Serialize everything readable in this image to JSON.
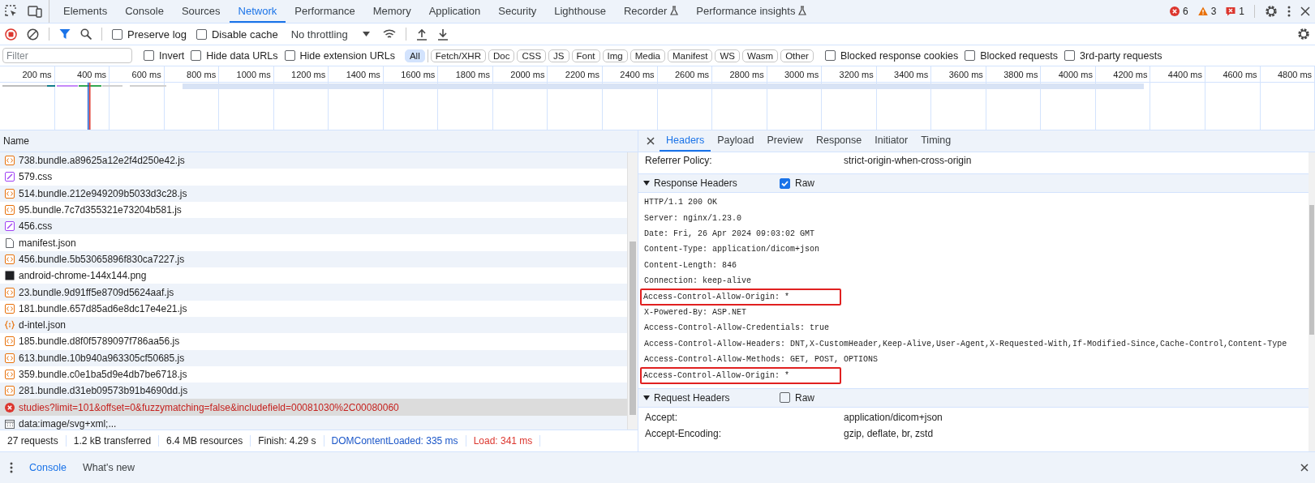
{
  "main_tabs": [
    {
      "label": "Elements",
      "kind": "plain",
      "selected": false
    },
    {
      "label": "Console",
      "kind": "plain",
      "selected": false
    },
    {
      "label": "Sources",
      "kind": "plain",
      "selected": false
    },
    {
      "label": "Network",
      "kind": "plain",
      "selected": true
    },
    {
      "label": "Performance",
      "kind": "plain",
      "selected": false
    },
    {
      "label": "Memory",
      "kind": "plain",
      "selected": false
    },
    {
      "label": "Application",
      "kind": "plain",
      "selected": false
    },
    {
      "label": "Security",
      "kind": "plain",
      "selected": false
    },
    {
      "label": "Lighthouse",
      "kind": "plain",
      "selected": false
    },
    {
      "label": "Recorder",
      "kind": "experimental",
      "selected": false
    },
    {
      "label": "Performance insights",
      "kind": "experimental",
      "selected": false
    }
  ],
  "issue_counts": [
    {
      "kind": "error",
      "count": "6"
    },
    {
      "kind": "warning",
      "count": "3"
    },
    {
      "kind": "issue",
      "count": "1"
    }
  ],
  "toolbar": {
    "recording": true,
    "options": [
      {
        "label": "Preserve log",
        "checked": false
      },
      {
        "label": "Disable cache",
        "checked": false
      }
    ],
    "throttling": "No throttling"
  },
  "filter": {
    "placeholder": "Filter",
    "options": [
      {
        "label": "Invert",
        "checked": false
      },
      {
        "label": "Hide data URLs",
        "checked": false
      },
      {
        "label": "Hide extension URLs",
        "checked": false
      }
    ],
    "types": [
      {
        "label": "All",
        "selected": true
      },
      {
        "label": "Fetch/XHR",
        "selected": false
      },
      {
        "label": "Doc",
        "selected": false
      },
      {
        "label": "CSS",
        "selected": false
      },
      {
        "label": "JS",
        "selected": false
      },
      {
        "label": "Font",
        "selected": false
      },
      {
        "label": "Img",
        "selected": false
      },
      {
        "label": "Media",
        "selected": false
      },
      {
        "label": "Manifest",
        "selected": false
      },
      {
        "label": "WS",
        "selected": false
      },
      {
        "label": "Wasm",
        "selected": false
      },
      {
        "label": "Other",
        "selected": false
      }
    ],
    "more_options": [
      {
        "label": "Blocked response cookies",
        "checked": false
      },
      {
        "label": "Blocked requests",
        "checked": false
      },
      {
        "label": "3rd-party requests",
        "checked": false
      }
    ]
  },
  "overview": {
    "ticks": [
      "200 ms",
      "400 ms",
      "600 ms",
      "800 ms",
      "1000 ms",
      "1200 ms",
      "1400 ms",
      "1600 ms",
      "1800 ms",
      "2000 ms",
      "2200 ms",
      "2400 ms",
      "2600 ms",
      "2800 ms",
      "3000 ms",
      "3200 ms",
      "3400 ms",
      "3600 ms",
      "3800 ms",
      "4000 ms",
      "4200 ms",
      "4400 ms",
      "4600 ms",
      "4800 ms"
    ]
  },
  "requests": {
    "column": "Name",
    "rows": [
      {
        "name": "738.bundle.a89625a12e2f4d250e42.js",
        "kind": "script",
        "selected": false
      },
      {
        "name": "579.css",
        "kind": "stylesheet",
        "selected": false
      },
      {
        "name": "514.bundle.212e949209b5033d3c28.js",
        "kind": "script",
        "selected": false
      },
      {
        "name": "95.bundle.7c7d355321e73204b581.js",
        "kind": "script",
        "selected": false
      },
      {
        "name": "456.css",
        "kind": "stylesheet",
        "selected": false
      },
      {
        "name": "manifest.json",
        "kind": "document",
        "selected": false
      },
      {
        "name": "456.bundle.5b53065896f830ca7227.js",
        "kind": "script",
        "selected": false
      },
      {
        "name": "android-chrome-144x144.png",
        "kind": "image",
        "selected": false
      },
      {
        "name": "23.bundle.9d91ff5e8709d5624aaf.js",
        "kind": "script",
        "selected": false
      },
      {
        "name": "181.bundle.657d85ad6e8dc17e4e21.js",
        "kind": "script",
        "selected": false
      },
      {
        "name": "d-intel.json",
        "kind": "json",
        "selected": false
      },
      {
        "name": "185.bundle.d8f0f5789097f786aa56.js",
        "kind": "script",
        "selected": false
      },
      {
        "name": "613.bundle.10b940a963305cf50685.js",
        "kind": "script",
        "selected": false
      },
      {
        "name": "359.bundle.c0e1ba5d9e4db7be6718.js",
        "kind": "script",
        "selected": false
      },
      {
        "name": "281.bundle.d31eb09573b91b4690dd.js",
        "kind": "script",
        "selected": false
      },
      {
        "name": "studies?limit=101&offset=0&fuzzymatching=false&includefield=00081030%2C00080060",
        "kind": "error",
        "selected": true
      },
      {
        "name": "data:image/svg+xml;...",
        "kind": "data",
        "selected": false
      }
    ]
  },
  "status_bar": [
    {
      "text": "27 requests",
      "kind": "plain"
    },
    {
      "text": "1.2 kB transferred",
      "kind": "plain"
    },
    {
      "text": "6.4 MB resources",
      "kind": "plain"
    },
    {
      "text": "Finish: 4.29 s",
      "kind": "plain"
    },
    {
      "text": "DOMContentLoaded: 335 ms",
      "kind": "dom"
    },
    {
      "text": "Load: 341 ms",
      "kind": "load"
    }
  ],
  "details": {
    "tabs": [
      {
        "label": "Headers",
        "selected": true
      },
      {
        "label": "Payload",
        "selected": false
      },
      {
        "label": "Preview",
        "selected": false
      },
      {
        "label": "Response",
        "selected": false
      },
      {
        "label": "Initiator",
        "selected": false
      },
      {
        "label": "Timing",
        "selected": false
      }
    ],
    "general": [
      {
        "name": "Referrer Policy:",
        "value": "strict-origin-when-cross-origin"
      }
    ],
    "response_headers": {
      "title": "Response Headers",
      "expanded": true,
      "raw_label": "Raw",
      "raw": true,
      "lines": [
        {
          "text": "HTTP/1.1 200 OK",
          "highlighted": false
        },
        {
          "text": "Server: nginx/1.23.0",
          "highlighted": false
        },
        {
          "text": "Date: Fri, 26 Apr 2024 09:03:02 GMT",
          "highlighted": false
        },
        {
          "text": "Content-Type: application/dicom+json",
          "highlighted": false
        },
        {
          "text": "Content-Length: 846",
          "highlighted": false
        },
        {
          "text": "Connection: keep-alive",
          "highlighted": false
        },
        {
          "text": "Access-Control-Allow-Origin: *",
          "highlighted": true
        },
        {
          "text": "X-Powered-By: ASP.NET",
          "highlighted": false
        },
        {
          "text": "Access-Control-Allow-Credentials: true",
          "highlighted": false
        },
        {
          "text": "Access-Control-Allow-Headers: DNT,X-CustomHeader,Keep-Alive,User-Agent,X-Requested-With,If-Modified-Since,Cache-Control,Content-Type",
          "highlighted": false
        },
        {
          "text": "Access-Control-Allow-Methods: GET, POST, OPTIONS",
          "highlighted": false
        },
        {
          "text": "Access-Control-Allow-Origin: *",
          "highlighted": true
        }
      ]
    },
    "request_headers": {
      "title": "Request Headers",
      "expanded": true,
      "raw_label": "Raw",
      "raw": false,
      "rows": [
        {
          "name": "Accept:",
          "value": "application/dicom+json"
        },
        {
          "name": "Accept-Encoding:",
          "value": "gzip, deflate, br, zstd"
        }
      ]
    }
  },
  "drawer": {
    "tabs": [
      {
        "label": "Console",
        "selected": true
      },
      {
        "label": "What's new",
        "selected": false
      }
    ]
  }
}
